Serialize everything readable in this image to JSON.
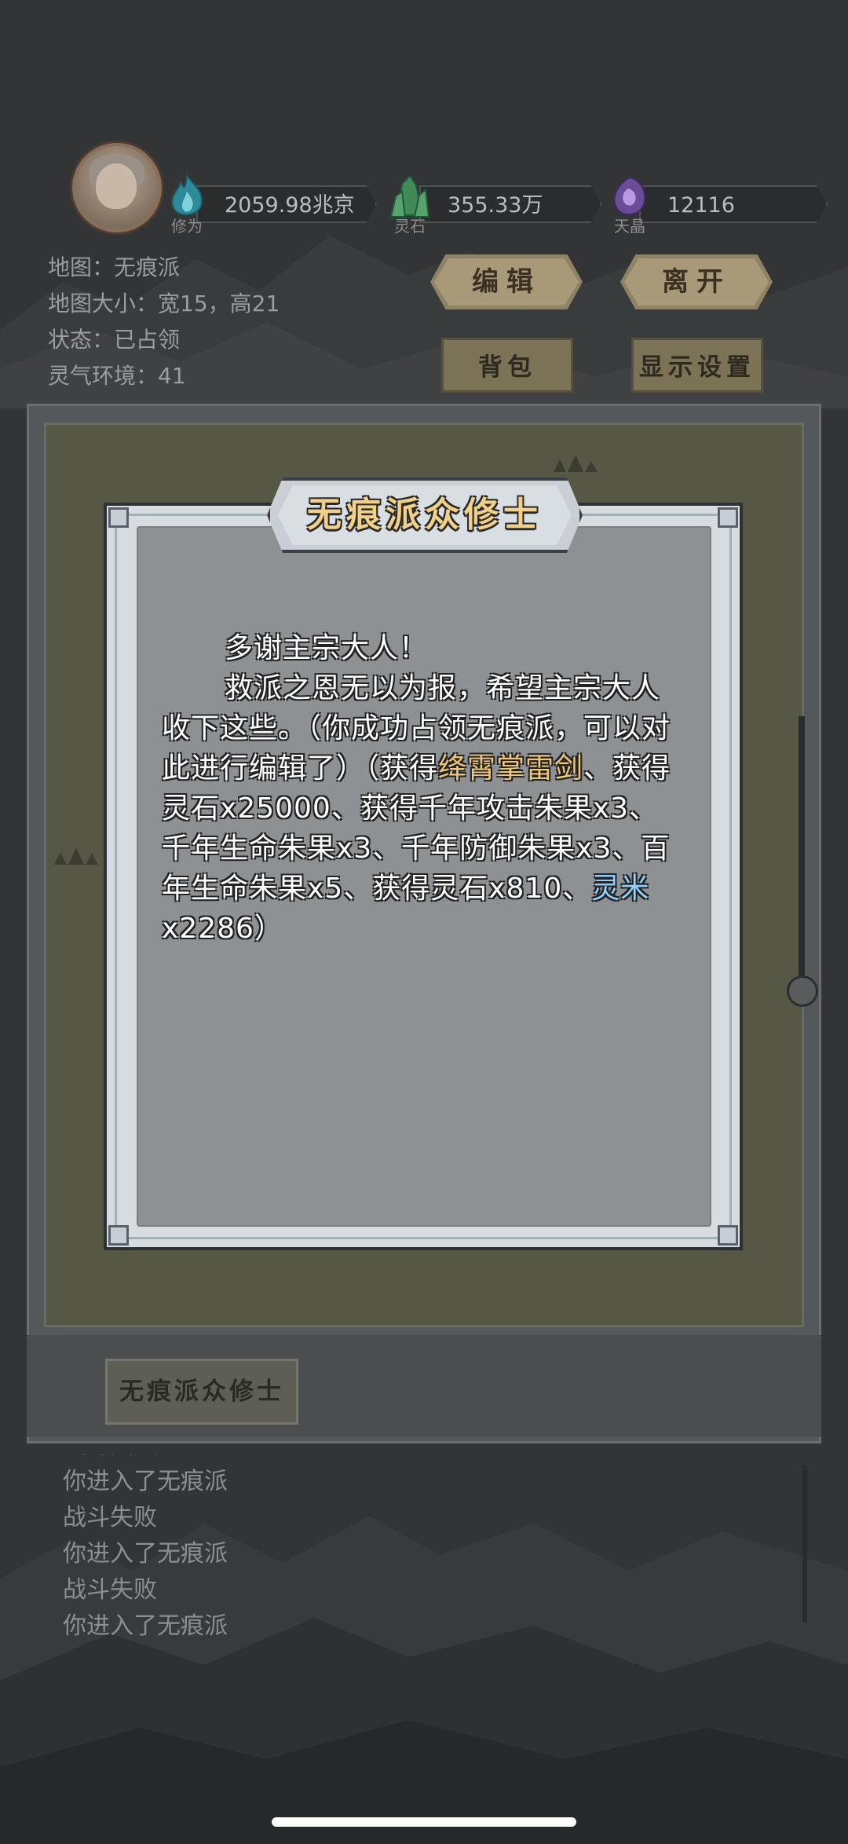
{
  "top_bar": {
    "resources": [
      {
        "icon": "cultivation-flame-icon",
        "caption": "修为",
        "value": "2059.98兆京",
        "color": "#3aa6b5"
      },
      {
        "icon": "spirit-stone-icon",
        "caption": "灵石",
        "value": "355.33万",
        "color": "#4a9a62"
      },
      {
        "icon": "crystal-icon",
        "caption": "天晶",
        "value": "12116",
        "color": "#7a5aa8"
      }
    ]
  },
  "map_info": {
    "map": "地图：无痕派",
    "size": "地图大小：宽15，高21",
    "status": "状态：已占领",
    "spirit": "灵气环境：41"
  },
  "buttons": {
    "edit": "编辑",
    "leave": "离开",
    "bag": "背包",
    "display_settings": "显示设置"
  },
  "tab": {
    "label": "无痕派众修士"
  },
  "log": [
    "战斗失败",
    "你进入了无痕派",
    "战斗失败",
    "你进入了无痕派",
    "战斗失败",
    "你进入了无痕派"
  ],
  "dialog": {
    "title": "无痕派众修士",
    "line1": "多谢主宗大人！",
    "p2_a": "救派之恩无以为报，希望主宗大人收下这些。（你成功占领无痕派，可以对此进行编辑了）（获得",
    "p2_gold": "绛霄掌雷剑",
    "p2_b": "、获得灵石x25000、获得千年攻击朱果x3、千年生命朱果x3、千年防御朱果x3、百年生命朱果x5、获得灵石x810、",
    "p2_blue": "灵米",
    "p2_c": "x2286）"
  }
}
